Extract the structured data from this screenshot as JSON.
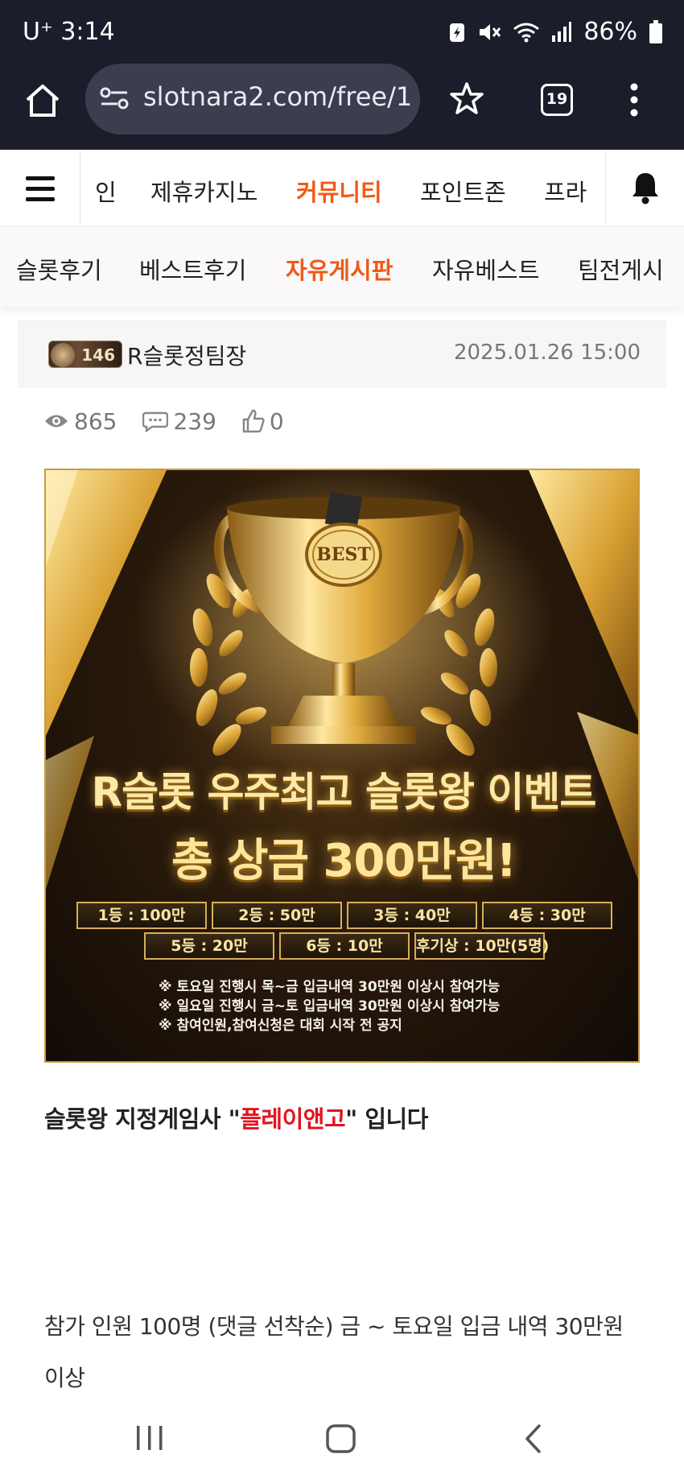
{
  "status_bar": {
    "time": "U⁺ 3:14",
    "battery": "86%"
  },
  "browser": {
    "url": "slotnara2.com/free/1",
    "tab_count": "19"
  },
  "site_nav": {
    "items": [
      "인",
      "제휴카지노",
      "커뮤니티",
      "포인트존",
      "프라"
    ],
    "active": "커뮤니티"
  },
  "sub_nav": {
    "items": [
      "슬롯후기",
      "베스트후기",
      "자유게시판",
      "자유베스트",
      "팀전게시"
    ],
    "active": "자유게시판"
  },
  "post": {
    "badge_level": "146",
    "author": "R슬롯정팀장",
    "date": "2025.01.26 15:00",
    "views": "865",
    "comments": "239",
    "likes": "0"
  },
  "banner": {
    "cup_label": "BEST",
    "title_line1": "R슬롯 우주최고 슬롯왕 이벤트",
    "title_line2": "총 상금 300만원!",
    "prizes_row1": [
      "1등 : 100만",
      "2등 : 50만",
      "3등 : 40만",
      "4등 : 30만"
    ],
    "prizes_row2": [
      "5등 : 20만",
      "6등 : 10만",
      "후기상 : 10만(5명)"
    ],
    "notes": [
      "※ 토요일 진행시 목~금 입금내역 30만원 이상시 참여가능",
      "※ 일요일 진행시 금~토 입금내역 30만원 이상시 참여가능",
      "※ 참여인원,참여신청은 대회 시작 전 공지"
    ]
  },
  "content": {
    "caption_before": "슬롯왕 지정게임사 \"",
    "caption_highlight": "플레이앤고",
    "caption_after": "\" 입니다",
    "paragraph": "참가 인원 100명 (댓글 선착순) 금 ~ 토요일 입금 내역 30만원 이상"
  },
  "colors": {
    "accent": "#f05a14",
    "highlight_red": "#e0141e",
    "browser_chrome": "#1b1d2a"
  }
}
